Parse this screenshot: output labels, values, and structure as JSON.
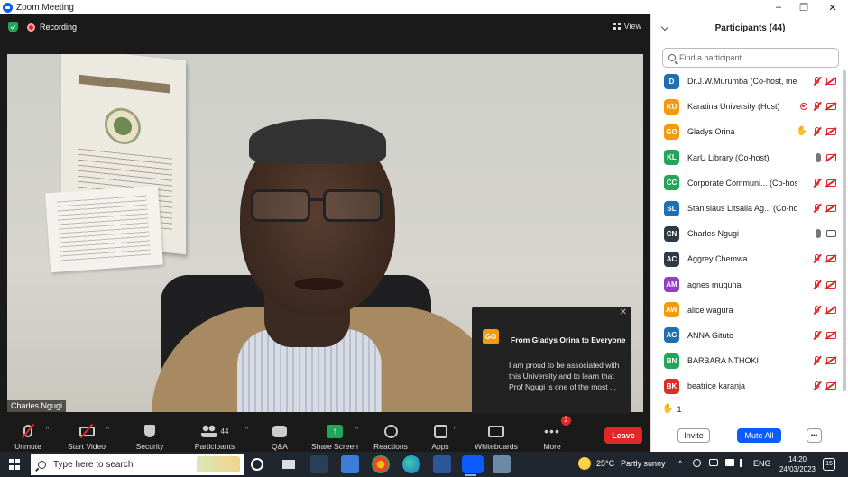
{
  "window": {
    "title": "Zoom Meeting",
    "minimize": "–",
    "maximize": "❐",
    "close": "✕"
  },
  "meeting": {
    "recording_label": "Recording",
    "view_label": "View",
    "speaker_name": "Charles Ngugi"
  },
  "chat_popup": {
    "avatar": "GO",
    "from": "From Gladys Orina to Everyone",
    "message": "I am proud to be associated with this University and to learn that Prof Ngugi is one of the most ...",
    "close": "✕"
  },
  "toolbar": {
    "unmute": "Unmute",
    "start_video": "Start Video",
    "security": "Security",
    "participants": "Participants",
    "participants_count": "44",
    "qa": "Q&A",
    "share_screen": "Share Screen",
    "reactions": "Reactions",
    "apps": "Apps",
    "whiteboards": "Whiteboards",
    "more": "More",
    "more_badge": "2",
    "leave": "Leave",
    "caret": "^",
    "share_arrow": "↑",
    "more_dots": "•••"
  },
  "participants_panel": {
    "title": "Participants (44)",
    "search_placeholder": "Find a participant",
    "hands_count": "1",
    "hand_glyph": "✋",
    "invite": "Invite",
    "mute_all": "Mute All",
    "more": "•••",
    "list": [
      {
        "initials": "D",
        "name": "Dr.J.W.Murumba (Co-host, me)",
        "color": "#1f6fb2",
        "mic": "muted",
        "video": "off"
      },
      {
        "initials": "KU",
        "name": "Karatina University (Host)",
        "color": "#f49a0b",
        "mic": "muted",
        "video": "off",
        "recording": true
      },
      {
        "initials": "GO",
        "name": "Gladys Orina",
        "color": "#f49a0b",
        "mic": "muted",
        "video": "off",
        "hand": true
      },
      {
        "initials": "KL",
        "name": "KarU Library (Co-host)",
        "color": "#23a55a",
        "mic": "on",
        "video": "off"
      },
      {
        "initials": "CC",
        "name": "Corporate Communi... (Co-host)",
        "color": "#23a55a",
        "mic": "muted",
        "video": "off"
      },
      {
        "initials": "SL",
        "name": "Stanislaus Litsalia Ag... (Co-host)",
        "color": "#1f6fb2",
        "mic": "muted",
        "video": "off"
      },
      {
        "initials": "CN",
        "name": "Charles Ngugi",
        "color": "#2d3a45",
        "mic": "on",
        "video": "on"
      },
      {
        "initials": "AC",
        "name": "Aggrey Chemwa",
        "color": "#2d3a45",
        "mic": "muted",
        "video": "off"
      },
      {
        "initials": "AM",
        "name": "agnes muguna",
        "color": "#8e3fc4",
        "mic": "muted",
        "video": "off"
      },
      {
        "initials": "AW",
        "name": "alice wagura",
        "color": "#f49a0b",
        "mic": "muted",
        "video": "off"
      },
      {
        "initials": "AG",
        "name": "ANNA Gituto",
        "color": "#1f6fb2",
        "mic": "muted",
        "video": "off"
      },
      {
        "initials": "BN",
        "name": "BARBARA NTHOKI",
        "color": "#23a55a",
        "mic": "muted",
        "video": "off"
      },
      {
        "initials": "BK",
        "name": "beatrice karanja",
        "color": "#d93025",
        "mic": "muted",
        "video": "off"
      }
    ]
  },
  "taskbar": {
    "search_placeholder": "Type here to search",
    "temperature": "25°C",
    "weather": "Partly sunny",
    "language": "ENG",
    "time": "14:20",
    "date": "24/03/2023",
    "notification_count": "15",
    "tray_caret": "^"
  }
}
